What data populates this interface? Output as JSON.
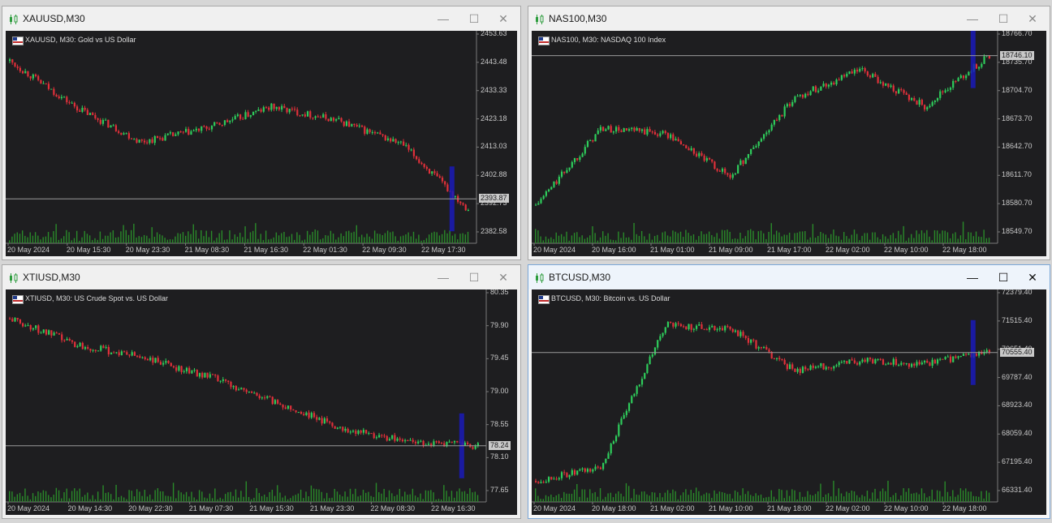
{
  "windows": [
    {
      "id": "xauusd",
      "title": "XAUUSD,M30",
      "chart_label": "XAUUSD, M30:  Gold vs US Dollar",
      "price_ticks": [
        "2453.63",
        "2443.48",
        "2433.33",
        "2423.18",
        "2413.03",
        "2402.88",
        "2392.73",
        "2382.58"
      ],
      "time_ticks": [
        "20 May 2024",
        "20 May 15:30",
        "20 May 23:30",
        "21 May 08:30",
        "21 May 16:30",
        "22 May 01:30",
        "22 May 09:30",
        "22 May 17:30"
      ],
      "current_price": "2393.87"
    },
    {
      "id": "nas100",
      "title": "NAS100,M30",
      "chart_label": "NAS100, M30:  NASDAQ 100 Index",
      "price_ticks": [
        "18766.70",
        "18735.70",
        "18704.70",
        "18673.70",
        "18642.70",
        "18611.70",
        "18580.70",
        "18549.70"
      ],
      "time_ticks": [
        "20 May 2024",
        "20 May 16:00",
        "21 May 01:00",
        "21 May 09:00",
        "21 May 17:00",
        "22 May 02:00",
        "22 May 10:00",
        "22 May 18:00"
      ],
      "current_price": "18746.10"
    },
    {
      "id": "xtiusd",
      "title": "XTIUSD,M30",
      "chart_label": "XTIUSD, M30:  US Crude Spot vs. US Dollar",
      "price_ticks": [
        "80.35",
        "79.90",
        "79.45",
        "79.00",
        "78.55",
        "78.10",
        "77.65"
      ],
      "time_ticks": [
        "20 May 2024",
        "20 May 14:30",
        "20 May 22:30",
        "21 May 07:30",
        "21 May 15:30",
        "21 May 23:30",
        "22 May 08:30",
        "22 May 16:30"
      ],
      "current_price": "78.24"
    },
    {
      "id": "btcusd",
      "title": "BTCUSD,M30",
      "chart_label": "BTCUSD, M30:  Bitcoin vs. US Dollar",
      "price_ticks": [
        "72379.40",
        "71515.40",
        "70651.40",
        "69787.40",
        "68923.40",
        "68059.40",
        "67195.40",
        "66331.40"
      ],
      "time_ticks": [
        "20 May 2024",
        "20 May 18:00",
        "21 May 02:00",
        "21 May 10:00",
        "21 May 18:00",
        "22 May 02:00",
        "22 May 10:00",
        "22 May 18:00"
      ],
      "current_price": "70555.40"
    }
  ],
  "window_controls": {
    "minimize": "—",
    "maximize": "☐",
    "close": "✕"
  },
  "colors": {
    "bull": "#2ecc5b",
    "bear": "#e0303a",
    "volume": "#2a8a2a",
    "depth": "#1a1ab8",
    "background": "#1e1e20"
  },
  "chart_data": [
    {
      "type": "candlestick",
      "symbol": "XAUUSD",
      "x": [
        "20 May 2024",
        "20 May 15:30",
        "20 May 23:30",
        "21 May 08:30",
        "21 May 16:30",
        "22 May 01:30",
        "22 May 09:30",
        "22 May 17:30"
      ],
      "close": [
        2445,
        2428,
        2415,
        2420,
        2428,
        2423,
        2414,
        2390
      ],
      "ylim": [
        2378,
        2455
      ],
      "last": 2393.87
    },
    {
      "type": "candlestick",
      "symbol": "NAS100",
      "x": [
        "20 May 2024",
        "20 May 16:00",
        "21 May 01:00",
        "21 May 09:00",
        "21 May 17:00",
        "22 May 02:00",
        "22 May 10:00",
        "22 May 18:00"
      ],
      "close": [
        18580,
        18665,
        18660,
        18612,
        18700,
        18730,
        18690,
        18746
      ],
      "ylim": [
        18540,
        18770
      ],
      "last": 18746.1
    },
    {
      "type": "candlestick",
      "symbol": "XTIUSD",
      "x": [
        "20 May 2024",
        "20 May 14:30",
        "20 May 22:30",
        "21 May 07:30",
        "21 May 15:30",
        "21 May 23:30",
        "22 May 08:30",
        "22 May 16:30"
      ],
      "close": [
        80.2,
        79.8,
        79.6,
        79.3,
        78.9,
        78.5,
        78.3,
        78.24
      ],
      "ylim": [
        77.4,
        80.6
      ],
      "last": 78.24
    },
    {
      "type": "candlestick",
      "symbol": "BTCUSD",
      "x": [
        "20 May 2024",
        "20 May 18:00",
        "21 May 02:00",
        "21 May 10:00",
        "21 May 18:00",
        "22 May 02:00",
        "22 May 10:00",
        "22 May 18:00"
      ],
      "close": [
        66600,
        67000,
        71400,
        71300,
        70000,
        70300,
        70200,
        70555
      ],
      "ylim": [
        66000,
        72400
      ],
      "last": 70555.4
    }
  ]
}
